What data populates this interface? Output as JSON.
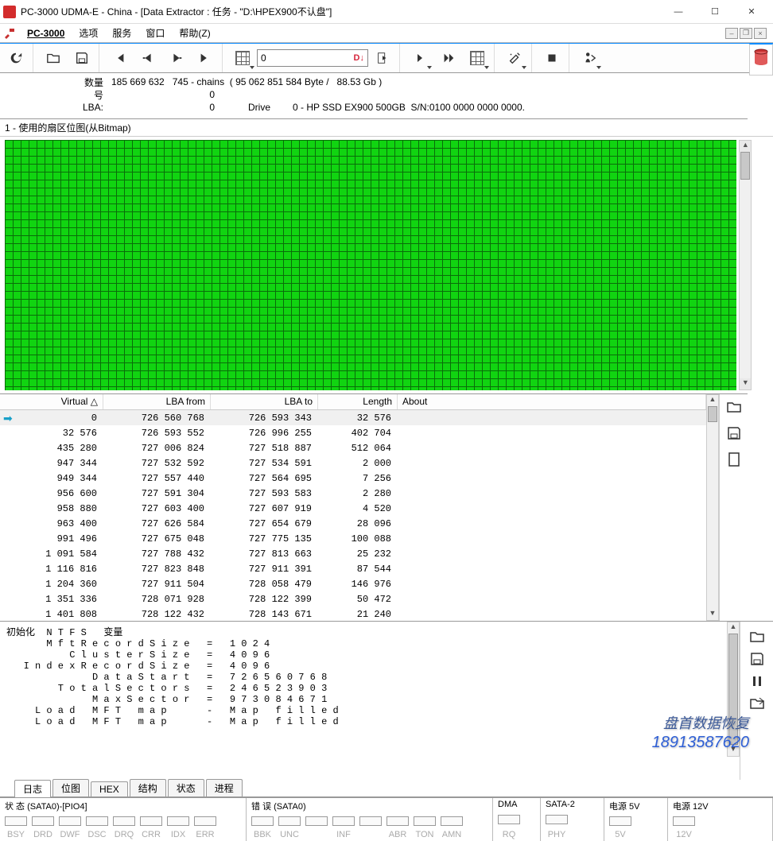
{
  "window": {
    "title": "PC-3000 UDMA-E - China - [Data Extractor : 任务 - \"D:\\HPEX900不认盘\"]"
  },
  "menu": {
    "app": "PC-3000",
    "items": [
      "选项",
      "服务",
      "窗口",
      "帮助(Z)"
    ]
  },
  "toolbar": {
    "jump_value": "0",
    "jump_marker": "D↓"
  },
  "info": {
    "count_label": "数量",
    "count_value": "185 669 632   745 - chains  ( 95 062 851 584 Byte /   88.53 Gb )",
    "num_label": "号",
    "num_value": "0",
    "lba_label": "LBA:",
    "lba_value": "0",
    "drive_label": "Drive",
    "drive_value": "0 - HP SSD EX900 500GB  S/N:0100 0000 0000 0000."
  },
  "bitmap_title": "1 - 使用的扇区位图(从Bitmap)",
  "table": {
    "headers": {
      "virtual": "Virtual  △",
      "lba_from": "LBA from",
      "lba_to": "LBA to",
      "length": "Length",
      "about": "About"
    },
    "rows": [
      {
        "v": "0",
        "lf": "726 560 768",
        "lt": "726 593 343",
        "ln": "32 576"
      },
      {
        "v": "32 576",
        "lf": "726 593 552",
        "lt": "726 996 255",
        "ln": "402 704"
      },
      {
        "v": "435 280",
        "lf": "727 006 824",
        "lt": "727 518 887",
        "ln": "512 064"
      },
      {
        "v": "947 344",
        "lf": "727 532 592",
        "lt": "727 534 591",
        "ln": "2 000"
      },
      {
        "v": "949 344",
        "lf": "727 557 440",
        "lt": "727 564 695",
        "ln": "7 256"
      },
      {
        "v": "956 600",
        "lf": "727 591 304",
        "lt": "727 593 583",
        "ln": "2 280"
      },
      {
        "v": "958 880",
        "lf": "727 603 400",
        "lt": "727 607 919",
        "ln": "4 520"
      },
      {
        "v": "963 400",
        "lf": "727 626 584",
        "lt": "727 654 679",
        "ln": "28 096"
      },
      {
        "v": "991 496",
        "lf": "727 675 048",
        "lt": "727 775 135",
        "ln": "100 088"
      },
      {
        "v": "1 091 584",
        "lf": "727 788 432",
        "lt": "727 813 663",
        "ln": "25 232"
      },
      {
        "v": "1 116 816",
        "lf": "727 823 848",
        "lt": "727 911 391",
        "ln": "87 544"
      },
      {
        "v": "1 204 360",
        "lf": "727 911 504",
        "lt": "728 058 479",
        "ln": "146 976"
      },
      {
        "v": "1 351 336",
        "lf": "728 071 928",
        "lt": "728 122 399",
        "ln": "50 472"
      },
      {
        "v": "1 401 808",
        "lf": "728 122 432",
        "lt": "728 143 671",
        "ln": "21 240"
      }
    ]
  },
  "log_lines": [
    "初始化  N T F S   变量",
    "       M f t R e c o r d S i z e   =   1 0 2 4",
    "           C l u s t e r S i z e   =   4 0 9 6",
    "   I n d e x R e c o r d S i z e   =   4 0 9 6",
    "               D a t a S t a r t   =   7 2 6 5 6 0 7 6 8",
    "         T o t a l S e c t o r s   =   2 4 6 5 2 3 9 0 3",
    "               M a x S e c t o r   =   9 7 3 0 8 4 6 7 1",
    "     L o a d   M F T   m a p       -   M a p   f i l l e d",
    "     L o a d   M F T   m a p       -   M a p   f i l l e d"
  ],
  "tabs": [
    "日志",
    "位图",
    "HEX",
    "结构",
    "状态",
    "进程"
  ],
  "status": {
    "g1_title": "状 态 (SATA0)-[PIO4]",
    "g1_labels": [
      "BSY",
      "DRD",
      "DWF",
      "DSC",
      "DRQ",
      "CRR",
      "IDX",
      "ERR"
    ],
    "g2_title": "错 误 (SATA0)",
    "g2_labels": [
      "BBK",
      "UNC",
      "",
      "INF",
      "",
      "ABR",
      "TON",
      "AMN"
    ],
    "g3_title": "DMA",
    "g3_labels": [
      "RQ"
    ],
    "g4_title": "SATA-2",
    "g4_labels": [
      "PHY"
    ],
    "g5_title": "电源 5V",
    "g5_labels": [
      "5V"
    ],
    "g6_title": "电源 12V",
    "g6_labels": [
      "12V"
    ]
  },
  "watermark": {
    "line1": "盘首数据恢复",
    "line2": "18913587620"
  }
}
